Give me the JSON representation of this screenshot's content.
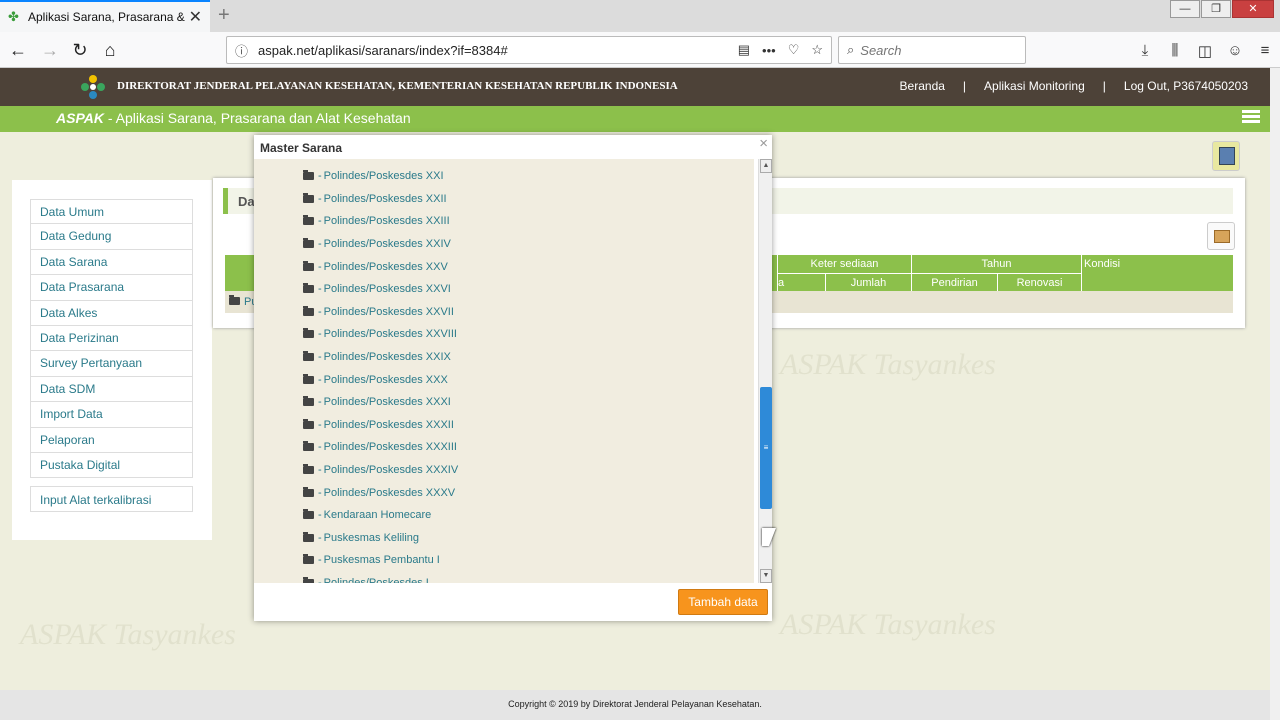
{
  "browser": {
    "tab_title": "Aplikasi Sarana, Prasarana & Pe",
    "url": "aspak.net/aplikasi/saranars/index?if=8384#",
    "search_placeholder": "Search"
  },
  "header": {
    "org_title": "DIREKTORAT JENDERAL PELAYANAN KESEHATAN, KEMENTERIAN KESEHATAN REPUBLIK INDONESIA",
    "nav": [
      "Beranda",
      "|",
      "Aplikasi Monitoring",
      "|",
      "Log Out, P3674050203"
    ],
    "app_name": "ASPAK",
    "app_subtitle": " - Aplikasi Sarana, Prasarana dan Alat Kesehatan"
  },
  "watermark": "ASPAK Tasyankes",
  "sidebar": {
    "items": [
      "Data Umum",
      "Data Gedung",
      "Data Sarana",
      "Data Prasarana",
      "Data Alkes",
      "Data Perizinan",
      "Survey Pertanyaan",
      "Data SDM",
      "Import Data",
      "Pelaporan",
      "Pustaka Digital"
    ],
    "extra": "Input Alat terkalibrasi"
  },
  "panel": {
    "title_fragment": "Da",
    "row_fragment": "Pu",
    "columns": {
      "keter_sediaan": "Keter sediaan",
      "tahun": "Tahun",
      "kondisi": "Kondisi",
      "a": "a",
      "jumlah": "Jumlah",
      "pendirian": "Pendirian",
      "renovasi": "Renovasi"
    }
  },
  "modal": {
    "title": "Master Sarana",
    "close": "×",
    "items": [
      "Polindes/Poskesdes XXI",
      "Polindes/Poskesdes XXII",
      "Polindes/Poskesdes XXIII",
      "Polindes/Poskesdes XXIV",
      "Polindes/Poskesdes XXV",
      "Polindes/Poskesdes XXVI",
      "Polindes/Poskesdes XXVII",
      "Polindes/Poskesdes XXVIII",
      "Polindes/Poskesdes XXIX",
      "Polindes/Poskesdes XXX",
      "Polindes/Poskesdes XXXI",
      "Polindes/Poskesdes XXXII",
      "Polindes/Poskesdes XXXIII",
      "Polindes/Poskesdes XXXIV",
      "Polindes/Poskesdes XXXV",
      "Kendaraan Homecare",
      "Puskesmas Keliling",
      "Puskesmas Pembantu I",
      "Polindes/Poskesdes I"
    ],
    "add_button": "Tambah data",
    "scroll_position": 0.78
  },
  "footer": {
    "line1": "Copyright © 2019 by Direktorat Jenderal Pelayanan Kesehatan."
  },
  "colors": {
    "header_dark": "#4d4238",
    "header_green": "#8cc04b",
    "link": "#2a7a8a",
    "button_orange": "#f7941d"
  }
}
